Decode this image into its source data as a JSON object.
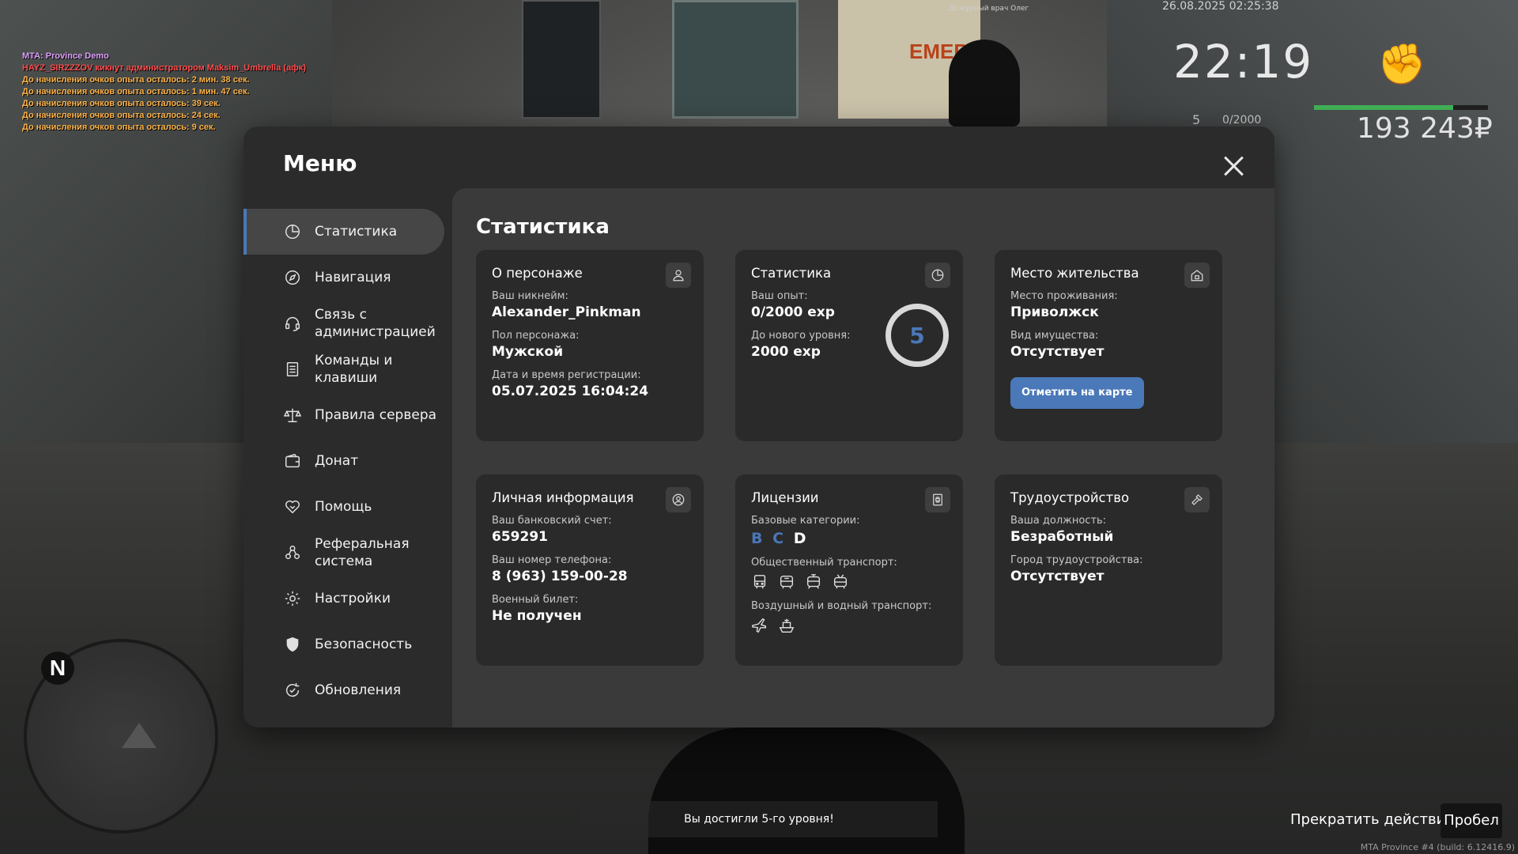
{
  "chat": {
    "lines": [
      "MTA: Province Demo",
      "HAYZ_SIRZZZOV кикнут администратором Maksim_Umbrella (афк)",
      "До начисления очков опыта осталось: 2 мин. 38 сек.",
      "До начисления очков опыта осталось: 1 мин. 47 сек.",
      "До начисления очков опыта осталось: 39 сек.",
      "До начисления очков опыта осталось: 24 сек.",
      "До начисления очков опыта осталось: 9 сек."
    ]
  },
  "scene": {
    "desk_sign": "Дежурный врач Олег"
  },
  "hud": {
    "date": "26.08.2025 02:25:38",
    "time": "22:19",
    "level": "5",
    "exp": "0/2000",
    "money": "193 243₽",
    "health_fraction": 0.8,
    "health_color": "#3fae55"
  },
  "minimap": {
    "north": "N"
  },
  "menu": {
    "title": "Меню",
    "close_icon": "close-icon",
    "sidebar": [
      {
        "label": "Статистика",
        "icon": "pie-chart-icon",
        "active": true
      },
      {
        "label": "Навигация",
        "icon": "compass-icon"
      },
      {
        "label": "Связь с администрацией",
        "icon": "headset-icon"
      },
      {
        "label": "Команды и клавиши",
        "icon": "list-icon"
      },
      {
        "label": "Правила сервера",
        "icon": "scales-icon"
      },
      {
        "label": "Донат",
        "icon": "wallet-icon"
      },
      {
        "label": "Помощь",
        "icon": "handshake-icon"
      },
      {
        "label": "Реферальная система",
        "icon": "people-icon"
      },
      {
        "label": "Настройки",
        "icon": "gear-icon"
      },
      {
        "label": "Безопасность",
        "icon": "shield-icon"
      },
      {
        "label": "Обновления",
        "icon": "refresh-icon"
      }
    ]
  },
  "stats": {
    "title": "Статистика",
    "about": {
      "title": "О персонаже",
      "nick_label": "Ваш никнейм:",
      "nick": "Alexander_Pinkman",
      "gender_label": "Пол персонажа:",
      "gender": "Мужской",
      "reg_label": "Дата и время регистрации:",
      "reg": "05.07.2025 16:04:24"
    },
    "statistics": {
      "title": "Статистика",
      "exp_label": "Ваш опыт:",
      "exp": "0/2000 exp",
      "next_label": "До нового уровня:",
      "next": "2000 exp",
      "level": "5"
    },
    "residence": {
      "title": "Место жительства",
      "place_label": "Место проживания:",
      "place": "Приволжск",
      "property_label": "Вид имущества:",
      "property": "Отсутствует",
      "button": "Отметить на карте"
    },
    "personal": {
      "title": "Личная информация",
      "bank_label": "Ваш банковский счет:",
      "bank": "659291",
      "phone_label": "Ваш номер телефона:",
      "phone": "8 (963) 159-00-28",
      "military_label": "Военный билет:",
      "military": "Не получен"
    },
    "licenses": {
      "title": "Лицензии",
      "base_label": "Базовые категории:",
      "categories": [
        {
          "name": "B",
          "active": true
        },
        {
          "name": "C",
          "active": true
        },
        {
          "name": "D",
          "active": false
        }
      ],
      "public_label": "Общественный транспорт:",
      "public_icons": [
        "bus-icon",
        "bus-icon",
        "tram-icon",
        "trolleybus-icon"
      ],
      "air_water_label": "Воздушный и водный транспорт:",
      "air_water_icons": [
        "plane-icon",
        "boat-icon"
      ]
    },
    "employment": {
      "title": "Трудоустройство",
      "position_label": "Ваша должность:",
      "position": "Безработный",
      "city_label": "Город трудоустройства:",
      "city": "Отсутствует"
    }
  },
  "bottom": {
    "notification": "Вы достигли 5-го уровня!",
    "stop_action": "Прекратить действие",
    "key": "Пробел",
    "build": "MTA Province #4 (build: 6.12416.9)"
  },
  "colors": {
    "accent": "#4a78b8",
    "panel": "#2b2b2b",
    "content": "#3a3a3a",
    "card": "#2a2a2a"
  }
}
